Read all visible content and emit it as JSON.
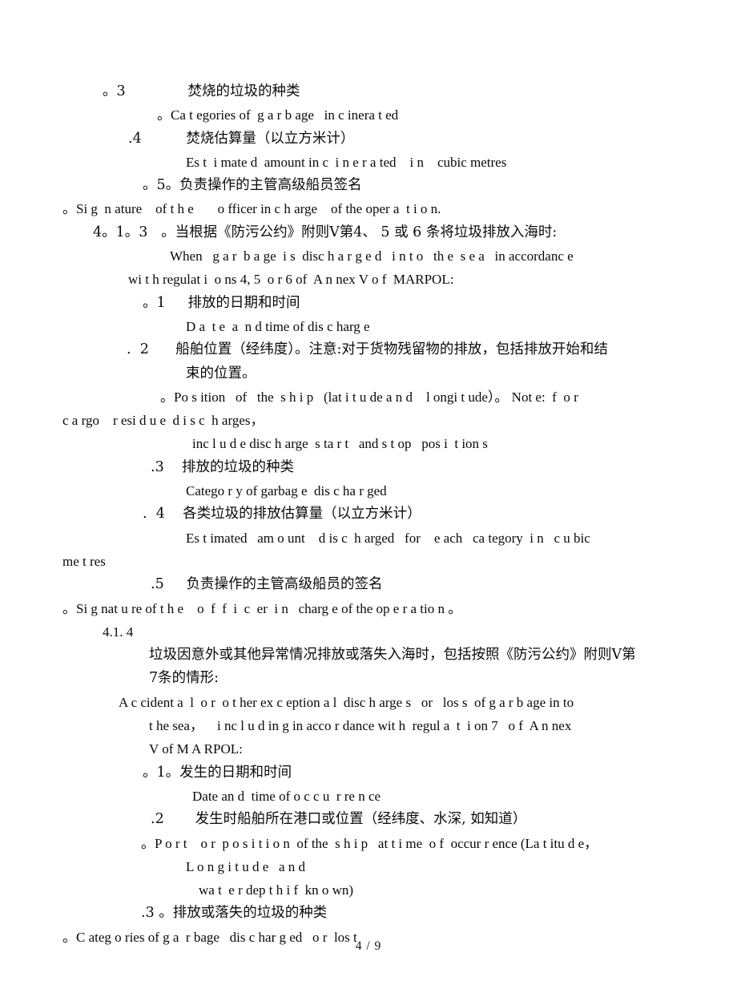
{
  "document": {
    "page_label": "4 / 9",
    "lines": [
      {
        "id": "l1",
        "lang": "cn",
        "indent": 128,
        "text": "。3              焚烧的垃圾的种类"
      },
      {
        "id": "l2",
        "lang": "en",
        "indent": 196,
        "text": "。Ca t egories of  g a r b age   in c inera t ed"
      },
      {
        "id": "l3",
        "lang": "cn",
        "indent": 160,
        "text": ".4          焚烧估算量（以立方米计）"
      },
      {
        "id": "l4",
        "lang": "en",
        "indent": 232,
        "text": "Es t  i mate d  amount in c  i n e r a ted    i n    cubic metres"
      },
      {
        "id": "l5",
        "lang": "cn",
        "indent": 178,
        "text": "。5。负责操作的主管高级船员签名"
      },
      {
        "id": "l6",
        "lang": "en",
        "indent": 78,
        "text": "。Si g  n ature    of t h e       o fficer in c h arge    of the oper a  t i o n."
      },
      {
        "id": "l7",
        "lang": "cn",
        "indent": 116,
        "text": "4。1。3   。当根据《防污公约》附则V第4、 5 或 6 条将垃圾排放入海时:"
      },
      {
        "id": "l8",
        "lang": "en",
        "indent": 212,
        "text": "When   g a r  b a ge  i s  disc h a r g e d   i n t o   th e  s e a   in accordanc e"
      },
      {
        "id": "l9",
        "lang": "en",
        "indent": 160,
        "text": "wi t h regulat i  o ns 4, 5  o r 6 of  A n nex V o f  MARPOL:"
      },
      {
        "id": "l10",
        "lang": "cn",
        "indent": 178,
        "text": "。1     排放的日期和时间"
      },
      {
        "id": "l11",
        "lang": "en",
        "indent": 232,
        "text": "D a  t e  a  n d time of dis c harg e"
      },
      {
        "id": "l12",
        "lang": "cn",
        "indent": 158,
        "text": ".  2      船舶位置（经纬度）。注意:对于货物残留物的排放，包括排放开始和结"
      },
      {
        "id": "l13",
        "lang": "cn",
        "indent": 232,
        "text": "束的位置。"
      },
      {
        "id": "l14",
        "lang": "en",
        "indent": 200,
        "text": "。Po s ition   of   the  s h i p   (lat i t u de a n d    l ongi t ude）。 Not e:  f  o r"
      },
      {
        "id": "l15",
        "lang": "en",
        "indent": 78,
        "text": "c a rgo    r esi d u e  d i s c  h arges，"
      },
      {
        "id": "l16",
        "lang": "en",
        "indent": 240,
        "text": "inc l u d e disc h arge  s ta r t   and s t op   pos i  t ion s"
      },
      {
        "id": "l17",
        "lang": "cn",
        "indent": 188,
        "text": ".3    排放的垃圾的种类"
      },
      {
        "id": "l18",
        "lang": "en",
        "indent": 232,
        "text": "Catego r y of garbag e  dis c ha r ged"
      },
      {
        "id": "l19",
        "lang": "cn",
        "indent": 178,
        "text": ".  4    各类垃圾的排放估算量（以立方米计）"
      },
      {
        "id": "l20",
        "lang": "en",
        "indent": 232,
        "text": "Es t imated   am o unt    d is c  h arged   for    e ach   ca tegory  i n   c u bic"
      },
      {
        "id": "l21",
        "lang": "en",
        "indent": 78,
        "text": "me t res"
      },
      {
        "id": "l22",
        "lang": "cn",
        "indent": 188,
        "text": ".5     负责操作的主管高级船员的签名"
      },
      {
        "id": "l23",
        "lang": "en",
        "indent": 78,
        "text": "。Si g nat u re of t h e    o  f  f  i  c  er  i n   charg e of the op e r a tio n 。"
      },
      {
        "id": "l24",
        "lang": "en",
        "indent": 128,
        "text": "4.1. 4"
      },
      {
        "id": "l25",
        "lang": "cn",
        "indent": 186,
        "text": "垃圾因意外或其他异常情况排放或落失入海时，包括按照《防污公约》附则V第"
      },
      {
        "id": "l26",
        "lang": "cn",
        "indent": 186,
        "text": "7条的情形:"
      },
      {
        "id": "l27",
        "lang": "en",
        "indent": 148,
        "text": "A c cident a  l  o r  o t her ex c eption a l  disc h arge s   or   los s  of g a r b age in to"
      },
      {
        "id": "l28",
        "lang": "en",
        "indent": 186,
        "text": "t he sea，    i nc l u d in g in acco r dance wit h  regul a  t  i on 7   o f  A n nex"
      },
      {
        "id": "l29",
        "lang": "en",
        "indent": 186,
        "text": "V of M A RPOL:"
      },
      {
        "id": "l30",
        "lang": "cn",
        "indent": 178,
        "text": "。1。发生的日期和时间"
      },
      {
        "id": "l31",
        "lang": "en",
        "indent": 240,
        "text": "Date an d  time of o c c u  r re n ce"
      },
      {
        "id": "l32",
        "lang": "cn",
        "indent": 188,
        "text": ".2       发生时船舶所在港口或位置（经纬度、水深, 如知道）"
      },
      {
        "id": "l33",
        "lang": "en",
        "indent": 176,
        "text": "。P o r t    o r  p o s i t i o n  of the  s h i p   at t i me  o f  occur r ence (La t itu d e，"
      },
      {
        "id": "l34",
        "lang": "en",
        "indent": 232,
        "text": "L o n g i t u d e   a n d"
      },
      {
        "id": "l35",
        "lang": "en",
        "indent": 248,
        "text": "wa t  e r dep t h i f  kn o wn)"
      },
      {
        "id": "l36",
        "lang": "cn",
        "indent": 176,
        "text": ".3 。排放或落失的垃圾的种类"
      },
      {
        "id": "l37",
        "lang": "en",
        "indent": 78,
        "text": "。C ateg o ries of g a  r bage   dis c har g ed   o r  los t"
      }
    ]
  }
}
